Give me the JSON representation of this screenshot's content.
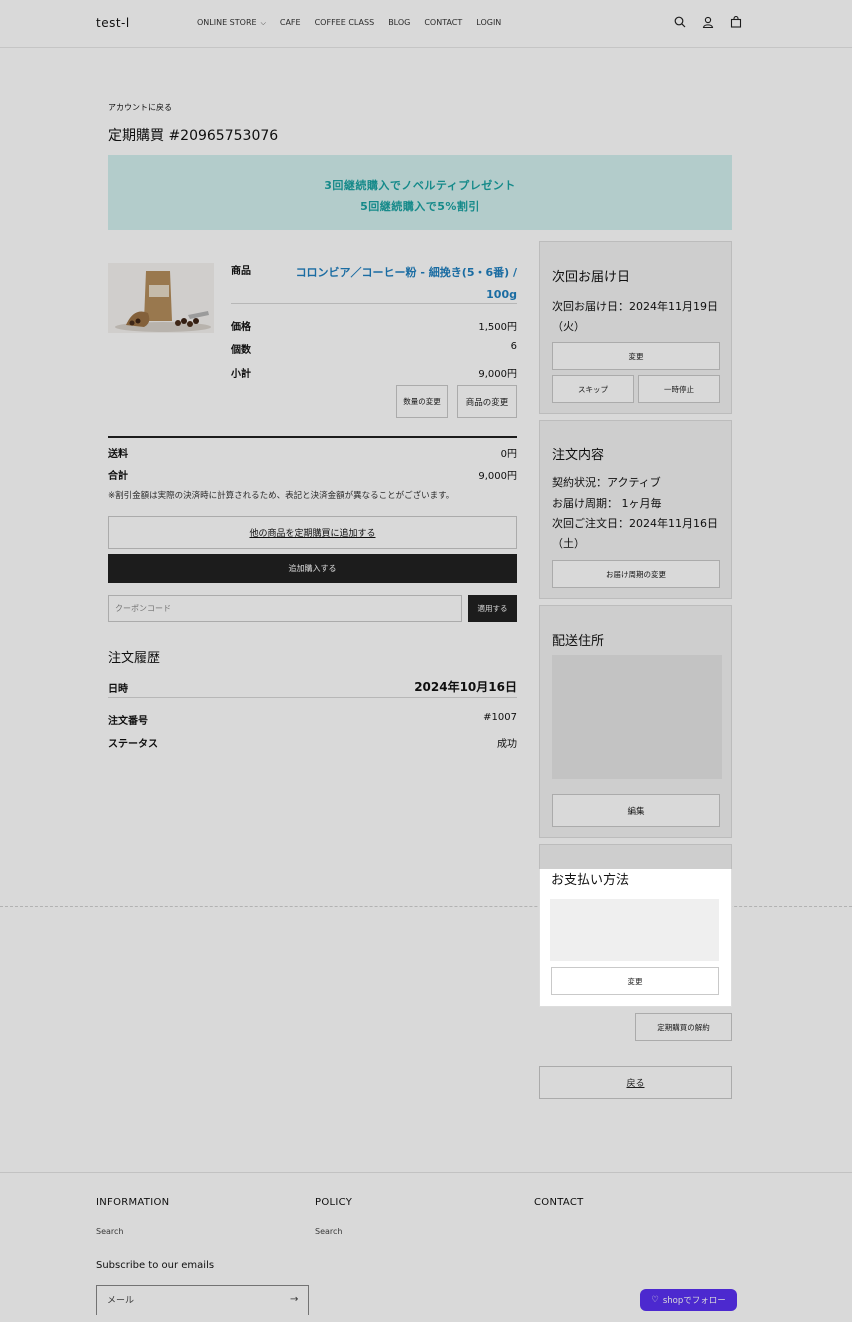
{
  "header": {
    "logo": "test-l",
    "nav": [
      "ONLINE STORE",
      "CAFE",
      "COFFEE CLASS",
      "BLOG",
      "CONTACT",
      "LOGIN"
    ],
    "icons": [
      "search-icon",
      "account-icon",
      "cart-icon"
    ]
  },
  "page": {
    "back_link": "アカウントに戻る",
    "title": "定期購買 #20965753076",
    "banner_line1": "3回継続購入でノベルティプレゼント",
    "banner_line2": "5回継続購入で5%割引"
  },
  "product": {
    "name_label": "商品",
    "name": "コロンビア／コーヒー粉 - 細挽き(5・6番) / 100g",
    "price_label": "価格",
    "price": "1,500円",
    "qty_label": "個数",
    "qty": "6",
    "subtotal_label": "小計",
    "subtotal": "9,000円",
    "change_qty_button": "数量の変更",
    "change_product_button": "商品の変更"
  },
  "summary": {
    "shipping_label": "送料",
    "shipping": "0円",
    "total_label": "合計",
    "total": "9,000円",
    "note": "※割引金額は実際の決済時に計算されるため、表記と決済金額が異なることがございます。",
    "add_other": "他の商品を定期購買に追加する",
    "add_buy": "追加購入する",
    "coupon_placeholder": "クーポンコード",
    "coupon_apply": "適用する"
  },
  "history": {
    "title": "注文履歴",
    "date_label": "日時",
    "date": "2024年10月16日",
    "order_no_label": "注文番号",
    "order_no": "#1007",
    "status_label": "ステータス",
    "status": "成功"
  },
  "next_delivery": {
    "title": "次回お届け日",
    "text": "次回お届け日：2024年11月19日（火）",
    "change": "変更",
    "skip": "スキップ",
    "pause": "一時停止"
  },
  "order_details": {
    "title": "注文内容",
    "status": "契約状況：アクティブ",
    "cycle": "お届け周期： 1ヶ月毎",
    "next_order": "次回ご注文日：2024年11月16日（土）",
    "change_cycle": "お届け周期の変更"
  },
  "shipping_address": {
    "title": "配送住所",
    "edit": "編集"
  },
  "payment": {
    "title": "お支払い方法",
    "change": "変更"
  },
  "actions": {
    "cancel": "定期購買の解約",
    "back": "戻る"
  },
  "footer": {
    "information": "INFORMATION",
    "policy": "POLICY",
    "contact": "CONTACT",
    "info_link": "Search",
    "policy_link": "Search",
    "subscribe": "Subscribe to our emails",
    "email_placeholder": "メール",
    "shop_follow": "shopでフォロー"
  },
  "colors": {
    "accent_teal": "#1aa3a3",
    "banner_bg": "#d3f0ef",
    "link_blue": "#1f7fbf",
    "dark_button": "#222222",
    "shop_purple": "#5a31f4"
  }
}
